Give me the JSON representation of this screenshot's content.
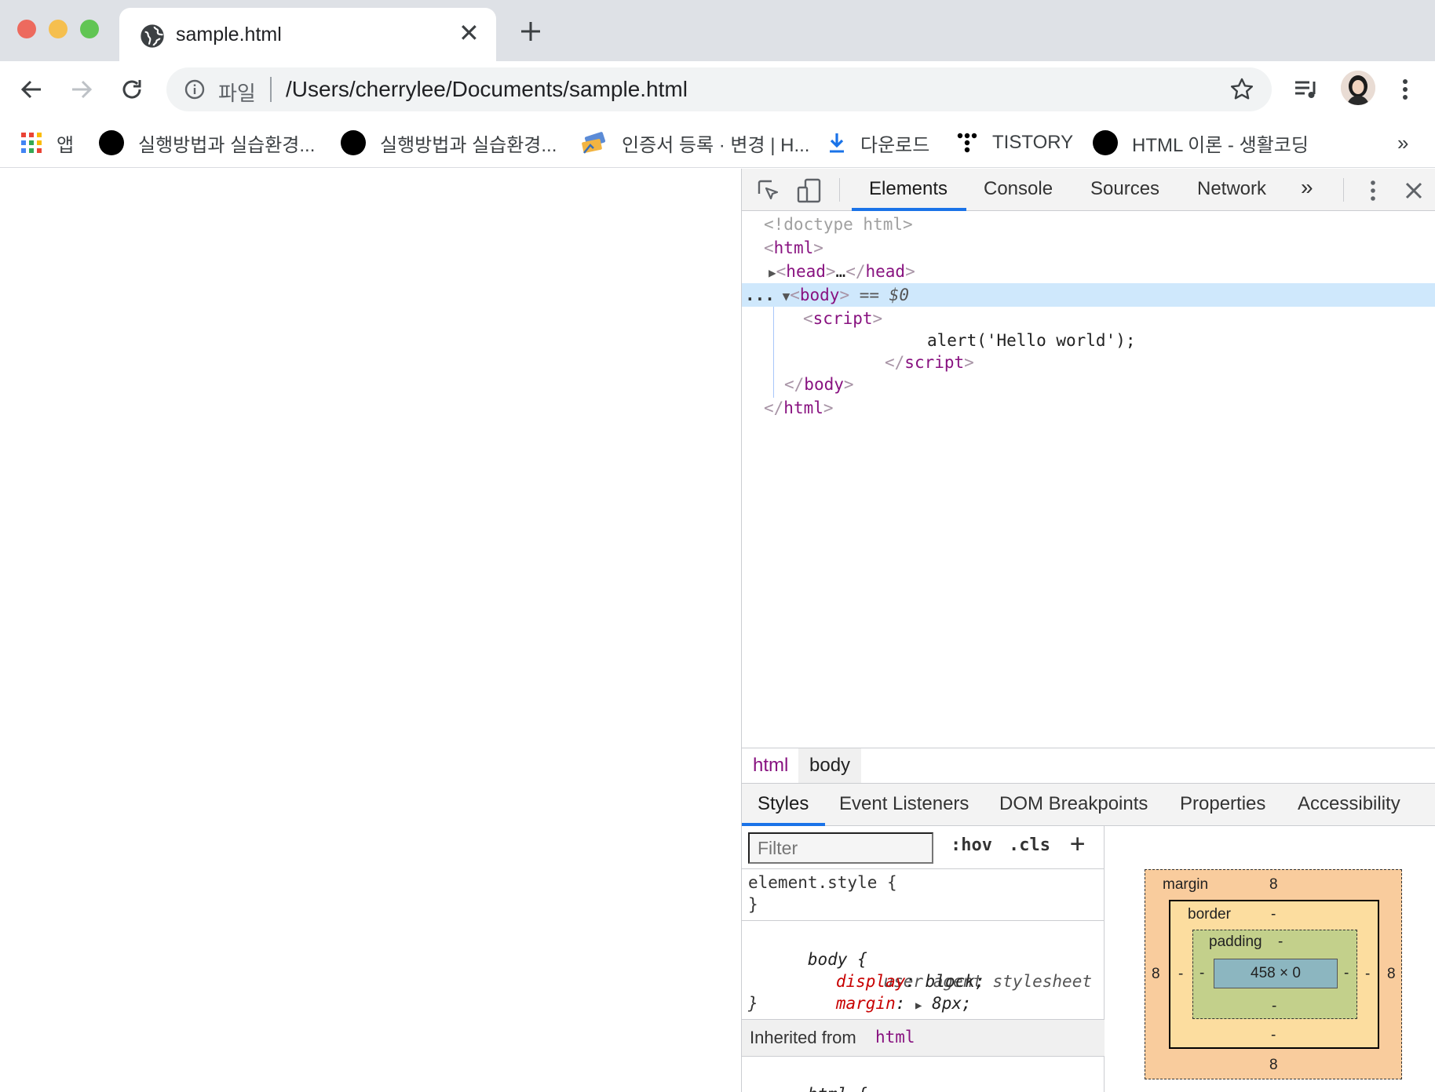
{
  "browser": {
    "tab": {
      "title": "sample.html",
      "close": "✕"
    },
    "omnibox": {
      "scheme": "파일",
      "url": "/Users/cherrylee/Documents/sample.html"
    },
    "bookmarks": [
      {
        "label": "앱",
        "icon": "apps-grid-icon"
      },
      {
        "label": "실행방법과 실습환경...",
        "icon": "circle-favicon"
      },
      {
        "label": "실행방법과 실습환경...",
        "icon": "circle-favicon"
      },
      {
        "label": "인증서 등록 · 변경 | H...",
        "icon": "certificate-favicon"
      },
      {
        "label": "다운로드",
        "icon": "download-icon"
      },
      {
        "label": "TISTORY",
        "icon": "tistory-favicon"
      },
      {
        "label": "HTML 이론 - 생활코딩",
        "icon": "circle-favicon"
      }
    ],
    "bookmarks_overflow": "»"
  },
  "devtools": {
    "tabs": [
      "Elements",
      "Console",
      "Sources",
      "Network"
    ],
    "tabs_overflow": "»",
    "active_tab": "Elements",
    "dom": {
      "doctype": "<!doctype html>",
      "html_open": "html",
      "head": "head",
      "head_ellipsis": "…",
      "body": "body",
      "selected_marker": "== $0",
      "row_dots": "...",
      "script": "script",
      "script_content": "alert('Hello world');",
      "lt": "<",
      "gt": ">",
      "close_lt": "</"
    },
    "breadcrumbs": [
      "html",
      "body"
    ],
    "sub_tabs": [
      "Styles",
      "Event Listeners",
      "DOM Breakpoints",
      "Properties",
      "Accessibility"
    ],
    "styles": {
      "filter_placeholder": "Filter",
      "hov": ":hov",
      "cls": ".cls",
      "plus": "+",
      "element_style": "element.style {",
      "close_brace": "}",
      "body_selector": "body {",
      "origin": "user agent stylesheet",
      "props": [
        {
          "name": "display",
          "value": "block;"
        },
        {
          "name": "margin",
          "value": "8px;"
        }
      ],
      "inherited_label": "Inherited from",
      "inherited_from": "html",
      "html_selector": "html {"
    },
    "box_model": {
      "margin_label": "margin",
      "margin_top": "8",
      "margin_right": "8",
      "margin_bottom": "8",
      "margin_left": "8",
      "border_label": "border",
      "border_value": "-",
      "padding_label": "padding",
      "padding_value": "-",
      "content": "458 × 0",
      "dash": "-"
    }
  },
  "colors": {
    "accent": "#1a73e8",
    "tag": "#881280",
    "selected_row": "#cfe8fc",
    "traffic_close": "#ed6a5e",
    "traffic_min": "#f5bf4f",
    "traffic_max": "#61c554"
  }
}
